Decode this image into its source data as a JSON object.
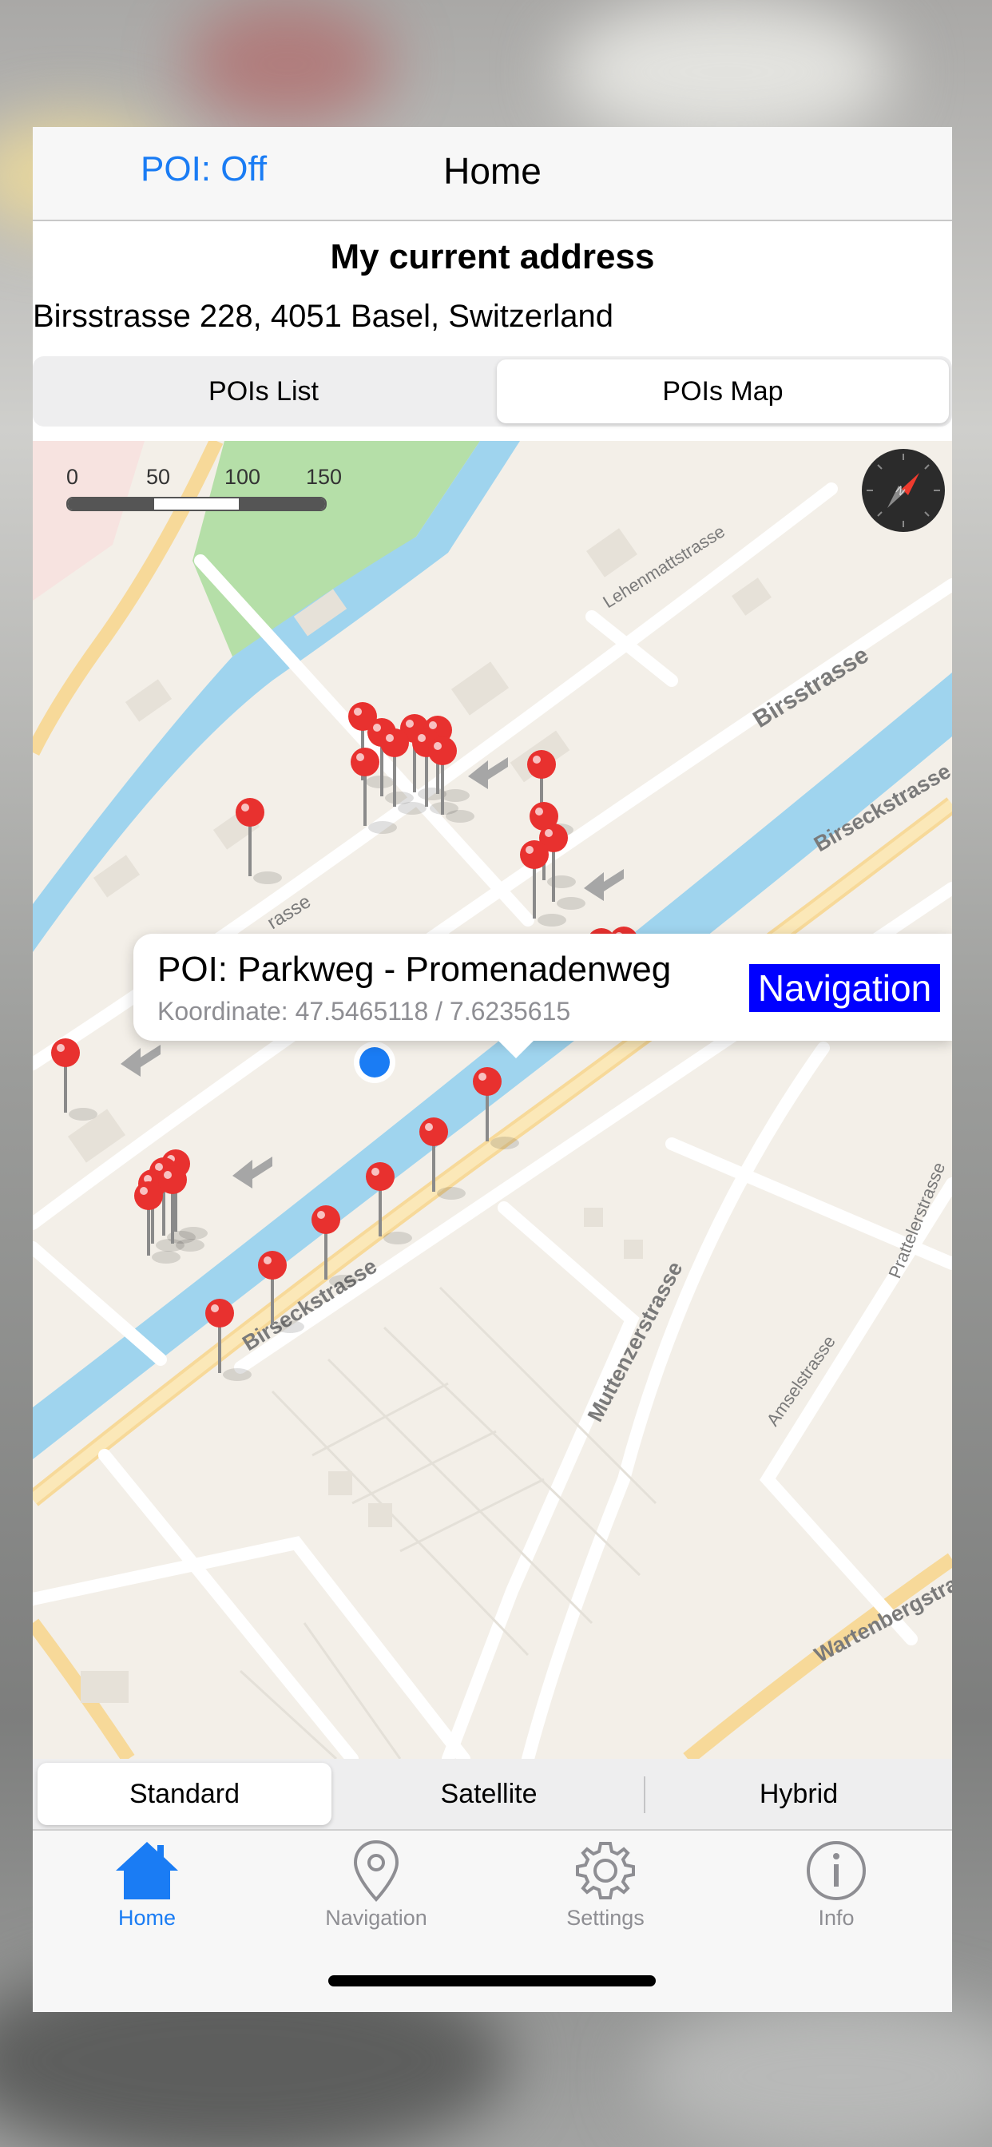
{
  "nav": {
    "poi_toggle": "POI: Off",
    "title": "Home"
  },
  "address": {
    "heading": "My current address",
    "value": "Birsstrasse 228, 4051 Basel, Switzerland"
  },
  "view_tabs": [
    {
      "label": "POIs List",
      "selected": false
    },
    {
      "label": "POIs Map",
      "selected": true
    }
  ],
  "map": {
    "scale_labels": [
      "0",
      "50",
      "100",
      "150 m"
    ],
    "street_labels": [
      "Lehenmattstrasse",
      "Birsstrasse",
      "Birseckstrasse",
      "rasse",
      "Birseckstrasse",
      "Muttenzerstrasse",
      "Amselstrasse",
      "Prattelerstrasse",
      "Wartenbergstra"
    ],
    "callout": {
      "title": "POI: Parkweg - Promenadenweg",
      "coordinates": "Koordinate: 47.5465118 / 7.6235615",
      "button": "Navigation"
    }
  },
  "map_type": [
    {
      "label": "Standard",
      "selected": true
    },
    {
      "label": "Satellite",
      "selected": false
    },
    {
      "label": "Hybrid",
      "selected": false
    }
  ],
  "tabbar": [
    {
      "label": "Home",
      "icon": "house-icon",
      "selected": true
    },
    {
      "label": "Navigation",
      "icon": "map-pin-icon",
      "selected": false
    },
    {
      "label": "Settings",
      "icon": "gear-icon",
      "selected": false
    },
    {
      "label": "Info",
      "icon": "info-circle-icon",
      "selected": false
    }
  ],
  "colors": {
    "accent": "#1a7cf4",
    "pin": "#e8312f",
    "water": "#9fd4ee",
    "park": "#b5dfa8",
    "inactive_tab": "#8e8e93",
    "nav_button": "#0000ff"
  }
}
